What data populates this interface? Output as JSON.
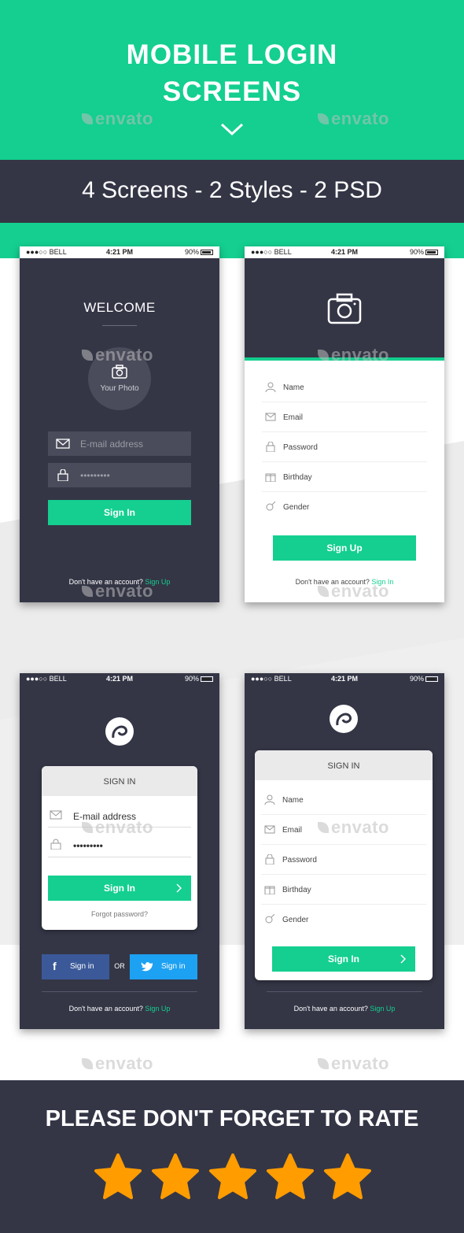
{
  "header": {
    "title_line1": "MOBILE LOGIN",
    "title_line2": "SCREENS",
    "subtitle": "4 Screens - 2 Styles - 2 PSD"
  },
  "watermark": "envato",
  "status_bar": {
    "carrier": "●●●○○ BELL",
    "time": "4:21 PM",
    "battery": "90%"
  },
  "screen1": {
    "title": "WELCOME",
    "photo_label": "Your Photo",
    "email_placeholder": "E-mail address",
    "password_value": "•••••••••",
    "button": "Sign In",
    "footer_text": "Don't have an account?",
    "footer_link": "Sign Up"
  },
  "screen2": {
    "fields": [
      "Name",
      "Email",
      "Password",
      "Birthday",
      "Gender"
    ],
    "button": "Sign Up",
    "footer_text": "Don't have an account?",
    "footer_link": "Sign In"
  },
  "screen3": {
    "card_title": "SIGN IN",
    "email_label": "E-mail address",
    "password_value": "•••••••••",
    "button": "Sign In",
    "forgot": "Forgot password?",
    "facebook": "Sign in",
    "twitter": "Sign in",
    "or": "OR",
    "footer_text": "Don't have an account?",
    "footer_link": "Sign Up"
  },
  "screen4": {
    "card_title": "SIGN IN",
    "fields": [
      "Name",
      "Email",
      "Password",
      "Birthday",
      "Gender"
    ],
    "button": "Sign In",
    "footer_text": "Don't have an account?",
    "footer_link": "Sign Up"
  },
  "footer": {
    "text": "PLEASE DON'T FORGET TO RATE",
    "stars": 5
  },
  "colors": {
    "accent": "#14cf8f",
    "dark": "#343646",
    "star": "#ff9c00",
    "facebook": "#3b5998",
    "twitter": "#1da1f2"
  }
}
